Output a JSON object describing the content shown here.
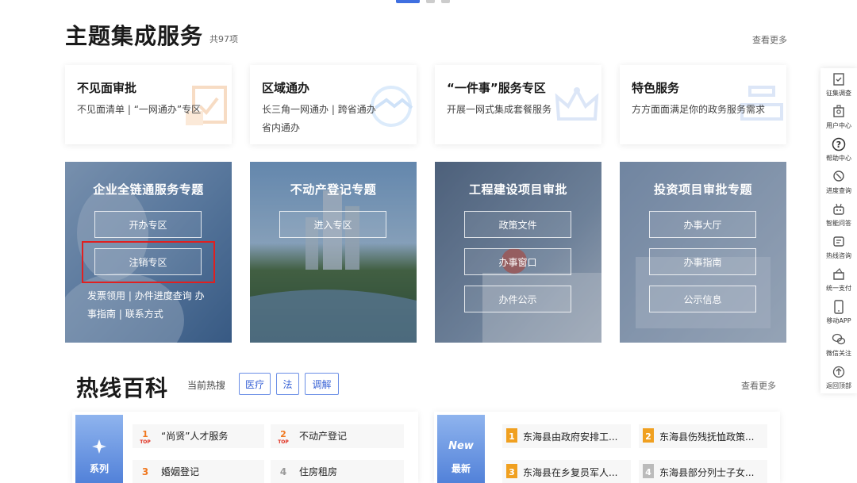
{
  "section": {
    "title": "主题集成服务",
    "count": "共97项",
    "more": "查看更多"
  },
  "cards": [
    {
      "title": "不见面审批",
      "links": [
        "不见面清单",
        "|",
        "“一网通办”专区"
      ]
    },
    {
      "title": "区域通办",
      "links": [
        "长三角一网通办",
        "|",
        "跨省通办",
        "省内通办"
      ]
    },
    {
      "title": "“一件事”服务专区",
      "links": [
        "开展一网式集成套餐服务"
      ]
    },
    {
      "title": "特色服务",
      "links": [
        "方方面面满足你的政务服务需求"
      ]
    }
  ],
  "topics": [
    {
      "title": "企业全链通服务专题",
      "buttons": [
        "开办专区",
        "注销专区"
      ],
      "links": [
        "发票领用",
        "|",
        "办件进度查询",
        "办事指南",
        "|",
        "联系方式"
      ]
    },
    {
      "title": "不动产登记专题",
      "buttons": [
        "进入专区"
      ],
      "links": []
    },
    {
      "title": "工程建设项目审批",
      "buttons": [
        "政策文件",
        "办事窗口",
        "办件公示"
      ],
      "links": []
    },
    {
      "title": "投资项目审批专题",
      "buttons": [
        "办事大厅",
        "办事指南",
        "公示信息"
      ],
      "links": []
    }
  ],
  "hotline": {
    "title": "热线百科",
    "label": "当前热搜",
    "tags": [
      "医疗",
      "法",
      "调解"
    ],
    "more": "查看更多",
    "series_tile": "系列",
    "series_items": [
      "“尚贤”人才服务",
      "不动产登记",
      "婚姻登记",
      "住房租房"
    ],
    "new_tile_top": "New",
    "new_tile": "最新",
    "new_items": [
      "东海县由政府安排工...",
      "东海县伤残抚恤政策...",
      "东海县在乡复员军人...",
      "东海县部分列士子女..."
    ]
  },
  "toolbar": [
    {
      "label": "征集调查",
      "icon": "survey-icon"
    },
    {
      "label": "用户中心",
      "icon": "user-center-icon"
    },
    {
      "label": "帮助中心",
      "icon": "help-icon"
    },
    {
      "label": "进度查询",
      "icon": "progress-query-icon"
    },
    {
      "label": "智能问答",
      "icon": "robot-icon"
    },
    {
      "label": "热线咨询",
      "icon": "hotline-icon"
    },
    {
      "label": "统一支付",
      "icon": "payment-icon"
    },
    {
      "label": "移动APP",
      "icon": "mobile-app-icon"
    },
    {
      "label": "微信关注",
      "icon": "wechat-icon"
    },
    {
      "label": "返回顶部",
      "icon": "back-to-top-icon"
    }
  ],
  "colors": {
    "accent": "#3f6fe0",
    "highlight": "#e02020",
    "tag_border": "#6a8ee6"
  }
}
